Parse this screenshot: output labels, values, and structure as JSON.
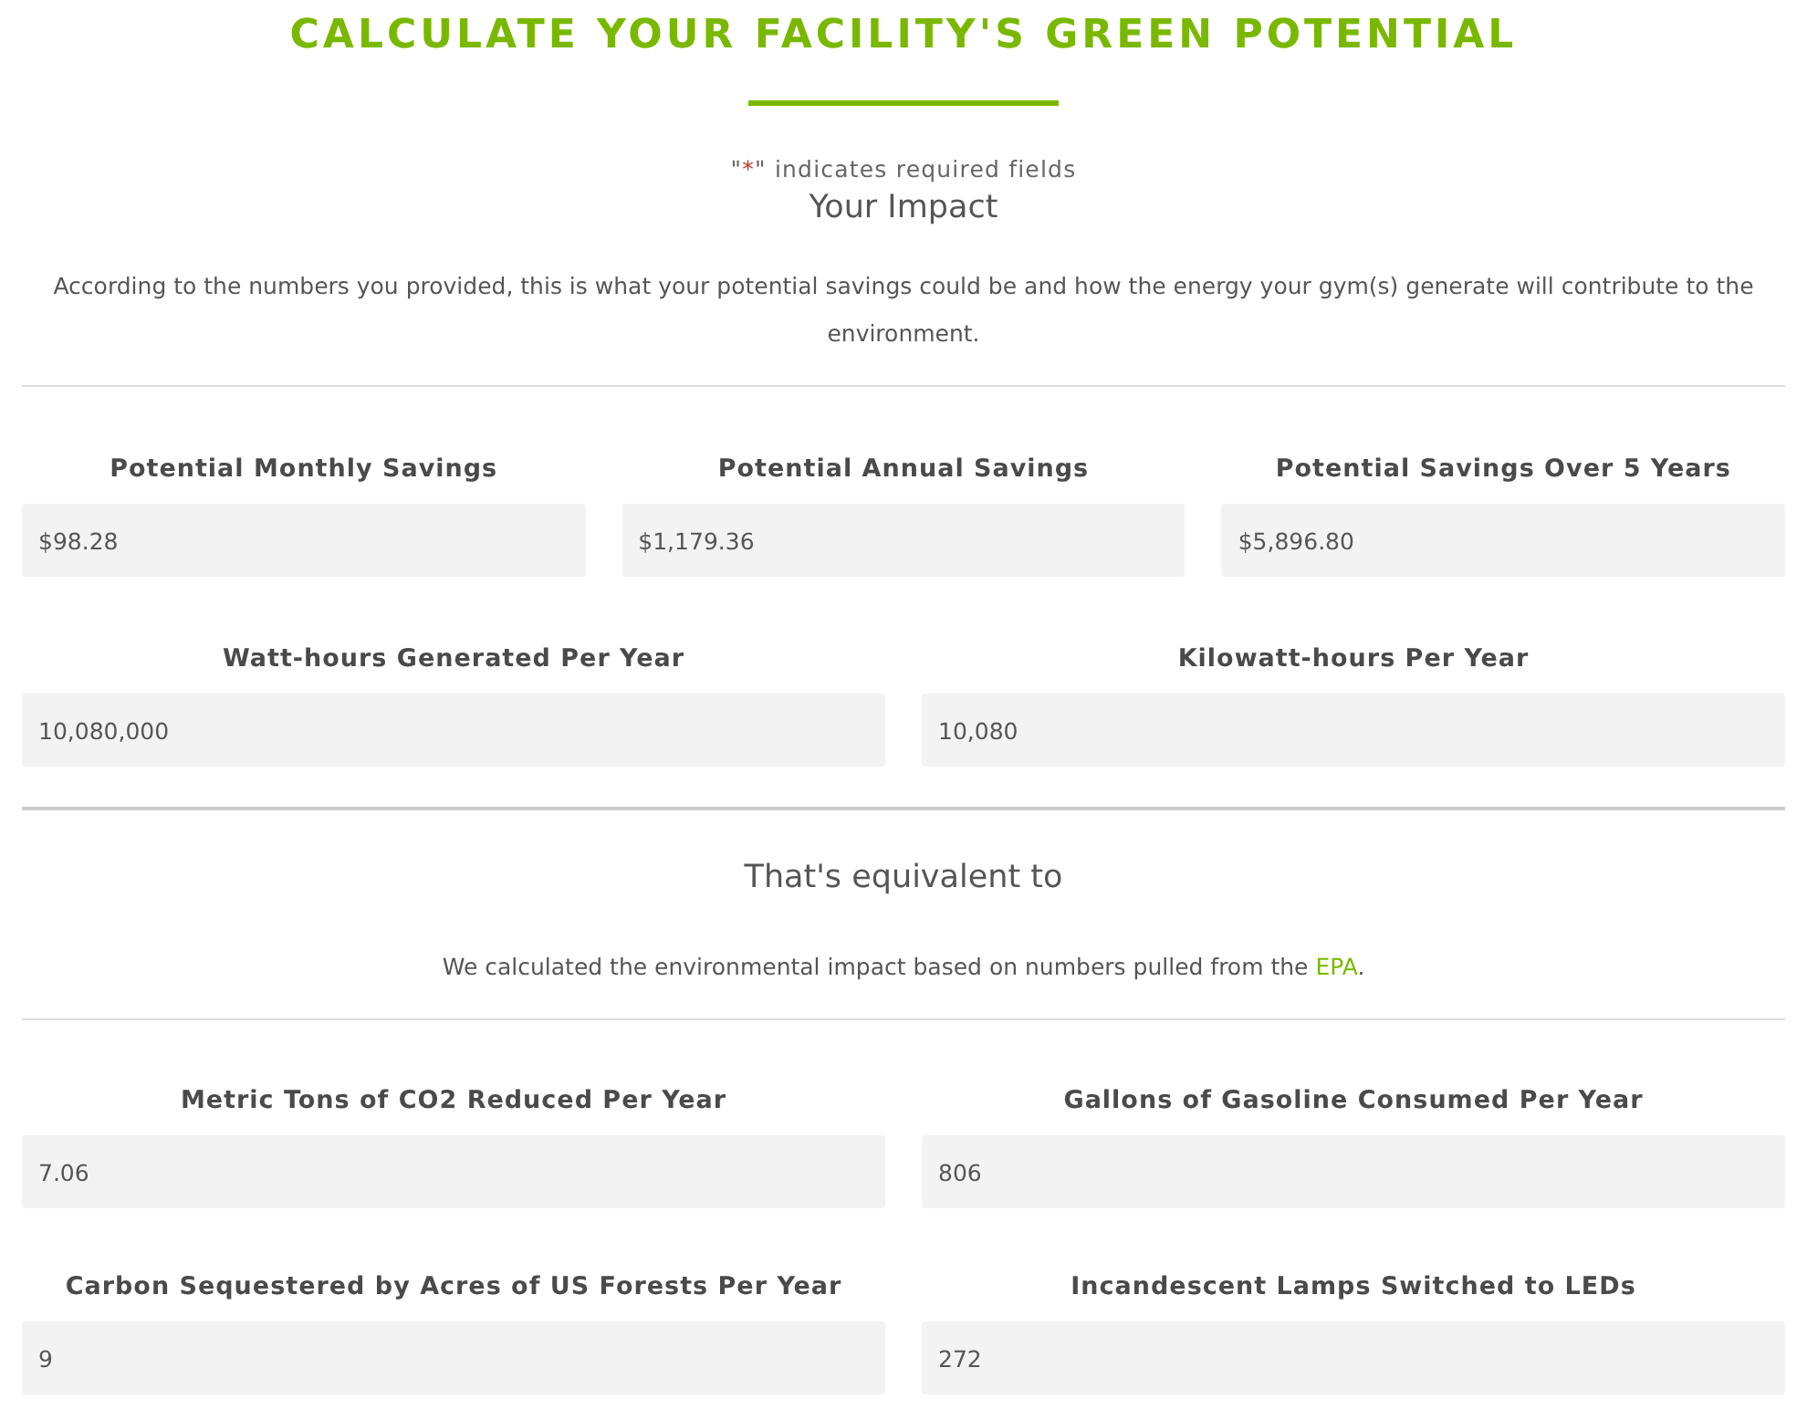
{
  "title": "CALCULATE YOUR FACILITY'S GREEN POTENTIAL",
  "required_note": {
    "before": "\"",
    "mark": "*",
    "after": "\" indicates required fields"
  },
  "impact": {
    "heading": "Your Impact",
    "text": "According to the numbers you provided, this is what your potential savings could be and how the energy your gym(s) generate will contribute to the environment.",
    "rows": [
      [
        {
          "label": "Potential Monthly Savings",
          "value": "$98.28"
        },
        {
          "label": "Potential Annual Savings",
          "value": "$1,179.36"
        },
        {
          "label": "Potential Savings Over 5 Years",
          "value": "$5,896.80"
        }
      ],
      [
        {
          "label": "Watt-hours Generated Per Year",
          "value": "10,080,000"
        },
        {
          "label": "Kilowatt-hours Per Year",
          "value": "10,080"
        }
      ]
    ]
  },
  "equivalent": {
    "heading": "That's equivalent to",
    "text_before": "We calculated the environmental impact based on numbers pulled from the ",
    "link": "EPA",
    "text_after": ".",
    "rows": [
      [
        {
          "label": "Metric Tons of CO2 Reduced Per Year",
          "value": "7.06"
        },
        {
          "label": "Gallons of Gasoline Consumed Per Year",
          "value": "806"
        }
      ],
      [
        {
          "label": "Carbon Sequestered by Acres of US Forests Per Year",
          "value": "9"
        },
        {
          "label": "Incandescent Lamps Switched to LEDs",
          "value": "272"
        }
      ]
    ]
  }
}
